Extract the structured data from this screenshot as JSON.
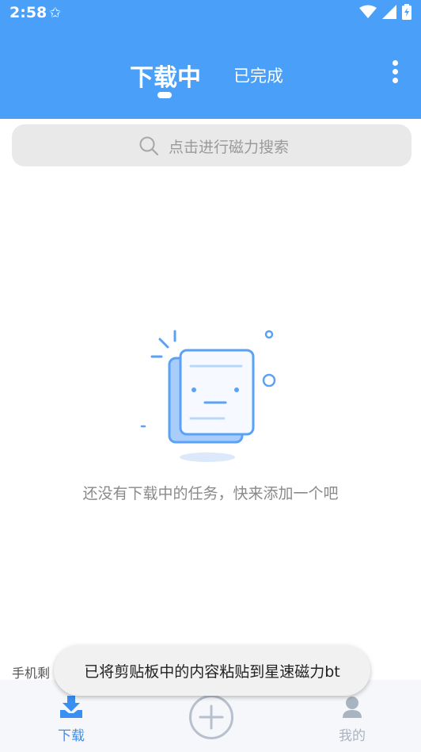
{
  "status_bar": {
    "time": "2:58"
  },
  "tabs": {
    "downloading": "下载中",
    "completed": "已完成"
  },
  "search": {
    "placeholder": "点击进行磁力搜索"
  },
  "empty_state": {
    "message": "还没有下载中的任务，快来添加一个吧"
  },
  "storage": {
    "text": "手机剩"
  },
  "toast": {
    "message": "已将剪贴板中的内容粘贴到星速磁力bt"
  },
  "bottom_nav": {
    "download_label": "下载",
    "mine_label": "我的"
  },
  "colors": {
    "header": "#4a9ff9",
    "active_nav": "#3a8ff2",
    "inactive_nav": "#a9b4c2",
    "illustration": "#5aa2f7"
  }
}
